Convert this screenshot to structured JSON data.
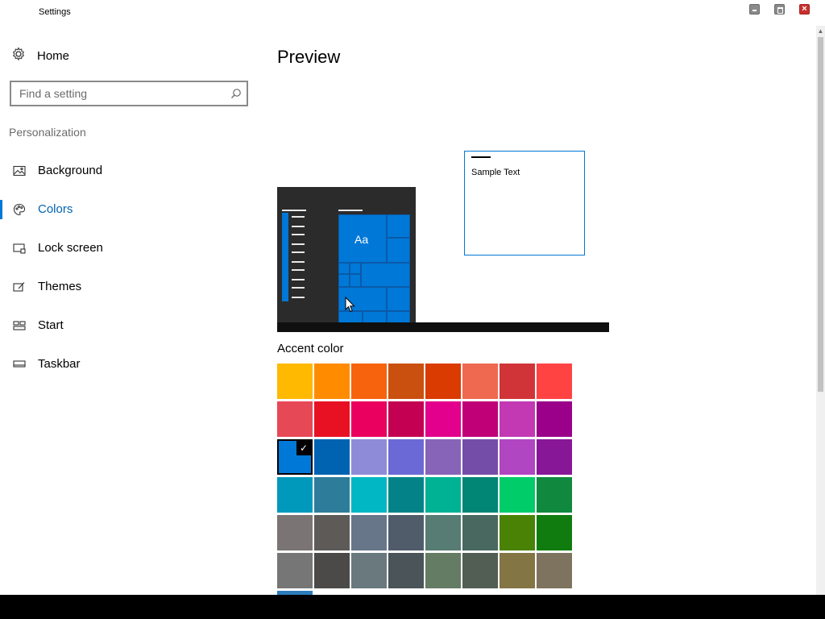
{
  "window": {
    "title": "Settings"
  },
  "nav": {
    "home_label": "Home",
    "search_placeholder": "Find a setting",
    "section_label": "Personalization",
    "items": [
      {
        "label": "Background",
        "icon": "image-icon",
        "selected": false
      },
      {
        "label": "Colors",
        "icon": "palette-icon",
        "selected": true
      },
      {
        "label": "Lock screen",
        "icon": "lock-screen-icon",
        "selected": false
      },
      {
        "label": "Themes",
        "icon": "themes-icon",
        "selected": false
      },
      {
        "label": "Start",
        "icon": "start-icon",
        "selected": false
      },
      {
        "label": "Taskbar",
        "icon": "taskbar-icon",
        "selected": false
      }
    ]
  },
  "main": {
    "preview_heading": "Preview",
    "sample_text": "Sample Text",
    "tile_label": "Aa",
    "accent_heading": "Accent color",
    "selected_accent": "#0078d7",
    "accent_colors": [
      "#ffb900",
      "#ff8c00",
      "#f7630c",
      "#ca5010",
      "#da3b01",
      "#ef6950",
      "#d13438",
      "#ff4343",
      "#e74856",
      "#e81123",
      "#ea005e",
      "#c30052",
      "#e3008c",
      "#bf0077",
      "#c239b3",
      "#9a0089",
      "#0078d7",
      "#0063b1",
      "#8e8cd8",
      "#6b69d6",
      "#8764b8",
      "#744da9",
      "#b146c2",
      "#881798",
      "#0099bc",
      "#2d7d9a",
      "#00b7c3",
      "#038387",
      "#00b294",
      "#018574",
      "#00cc6a",
      "#10893e",
      "#7a7574",
      "#5d5a58",
      "#68768a",
      "#515c6b",
      "#567c73",
      "#486860",
      "#498205",
      "#107c10",
      "#767676",
      "#4c4a48",
      "#69797e",
      "#4a5459",
      "#647c64",
      "#525e54",
      "#847545",
      "#7e735f"
    ]
  }
}
